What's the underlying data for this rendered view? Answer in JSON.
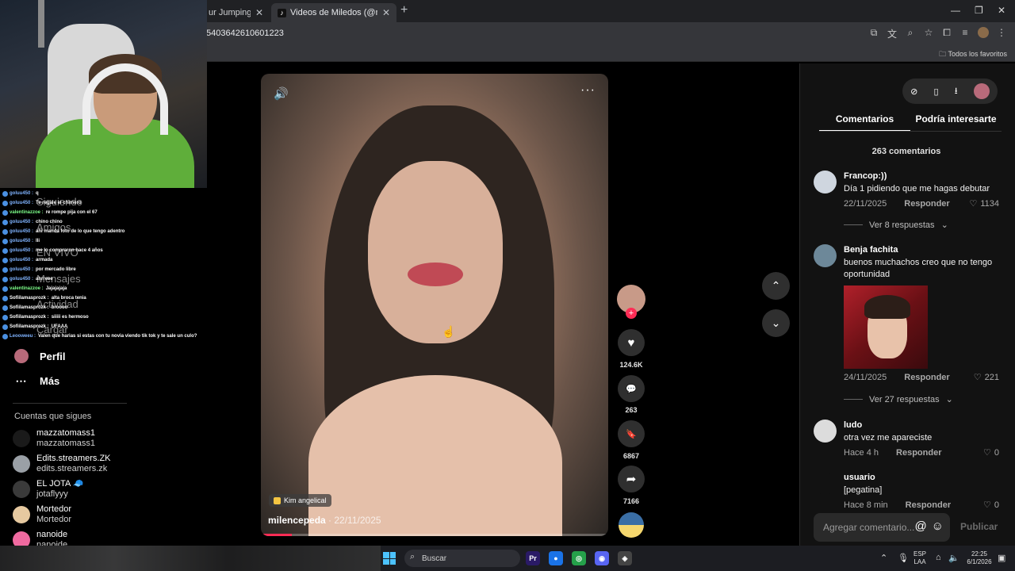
{
  "browser": {
    "tabs": [
      {
        "label": "ur Jumping Ski",
        "close": "✕"
      },
      {
        "label": "Videos de Miledos (@milen",
        "close": "✕"
      }
    ],
    "new_tab": "+",
    "url": "5403642610601223",
    "bookmarks_folder": "Todos los favoritos",
    "window_controls": [
      "—",
      "❐",
      "✕"
    ]
  },
  "chat": [
    {
      "user": "goluu450 :",
      "msg": "q",
      "color": "#7fb3ff"
    },
    {
      "user": "goluu450 :",
      "msg": "Te regale el chimero",
      "color": "#7fb3ff"
    },
    {
      "user": "valentinazzoe :",
      "msg": "re rompe pija con el 67",
      "color": "#7dff8a"
    },
    {
      "user": "goluu450 :",
      "msg": "chino chino",
      "color": "#7fb3ff"
    },
    {
      "user": "goluu450 :",
      "msg": "ahi manda foto de lo que tengo adentro",
      "color": "#7fb3ff"
    },
    {
      "user": "goluu450 :",
      "msg": "lli",
      "color": "#7fb3ff"
    },
    {
      "user": "goluu450 :",
      "msg": "me lo compraron hace 4 años",
      "color": "#7fb3ff"
    },
    {
      "user": "goluu450 :",
      "msg": "armada",
      "color": "#7fb3ff"
    },
    {
      "user": "goluu450 :",
      "msg": "por mercado libre",
      "color": "#7fb3ff"
    },
    {
      "user": "goluu450 :",
      "msg": "ahrreee",
      "color": "#7fb3ff"
    },
    {
      "user": "valentinazzoe :",
      "msg": "Jajajajaja",
      "color": "#7dff8a"
    },
    {
      "user": "Sofiilamasprozk :",
      "msg": "alta broca tenia",
      "color": "#ffffff"
    },
    {
      "user": "Sofiilamasprozk :",
      "msg": "broooo",
      "color": "#ffffff"
    },
    {
      "user": "Sofiilamasprozk :",
      "msg": "siiiii es hermoso",
      "color": "#ffffff"
    },
    {
      "user": "Sofiilamasprozk :",
      "msg": "UFAAA",
      "color": "#ffffff"
    },
    {
      "user": "Leooweeu :",
      "msg": "Valen que harias si estas con tu novia viendo tik tok y te sale un culo?",
      "color": "#7fb3ff"
    }
  ],
  "sidebar": {
    "ghost_items": [
      "Siguiendo",
      "Amigos",
      "EN VIVO",
      "Mensajes",
      "Actividad",
      "Cargar"
    ],
    "profile_label": "Perfil",
    "more_label": "Más",
    "more_icon": "⋯",
    "following_title": "Cuentas que sigues",
    "following": [
      {
        "name": "mazzatomass1",
        "handle": "mazzatomass1",
        "color": "#1a1a1a"
      },
      {
        "name": "Edits.streamers.ZK",
        "handle": "edits.streamers.zk",
        "color": "#9aa0a6"
      },
      {
        "name": "EL JOTA 🧢",
        "handle": "jotaflyyy",
        "color": "#3a3a3a"
      },
      {
        "name": "Mortedor",
        "handle": "Mortedor",
        "color": "#e6c9a0"
      },
      {
        "name": "nanoide",
        "handle": "nanoide",
        "color": "#f06aa0"
      }
    ]
  },
  "video": {
    "volume_icon": "🔊",
    "more_icon": "···",
    "tag": "Kim angelical",
    "author": "milencepeda",
    "date": " · 22/11/2025",
    "progress": 0.09
  },
  "actions": {
    "follow_plus": "+",
    "likes": "124.6K",
    "comments": "263",
    "saves": "6867",
    "shares": "7166",
    "like_icon": "♥",
    "comment_icon": "💬",
    "save_icon": "🔖",
    "share_icon": "➦",
    "up_icon": "⌃",
    "down_icon": "⌄"
  },
  "panel": {
    "tools": [
      "⊘",
      "▯",
      "⭳"
    ],
    "tabs": [
      "Comentarios",
      "Podría interesarte"
    ],
    "comment_count": "263 comentarios",
    "comments": [
      {
        "name": "Francop:))",
        "text": "Día 1 pidiendo que me hagas debutar",
        "time": "22/11/2025",
        "reply": "Responder",
        "likes": "1134",
        "avatar": "#cfd6df",
        "more": "Ver 8 respuestas"
      },
      {
        "name": "Benja fachita",
        "text": "buenos muchachos creo que no tengo oportunidad",
        "time": "24/11/2025",
        "reply": "Responder",
        "likes": "221",
        "avatar": "#6d8899",
        "more": "Ver 27 respuestas"
      },
      {
        "name": "ludo",
        "text": "otra vez me apareciste",
        "time": "Hace 4 h",
        "reply": "Responder",
        "likes": "0",
        "avatar": "#dcdcdc",
        "more": ""
      },
      {
        "name": "usuario",
        "text": "[pegatina]",
        "time": "Hace 8 min",
        "reply": "Responder",
        "likes": "0",
        "avatar": "#121212",
        "more": ""
      }
    ],
    "input_placeholder": "Agregar comentario...",
    "input_icons": [
      "@",
      "☺"
    ],
    "publish": "Publicar"
  },
  "taskbar": {
    "search": "Buscar",
    "lang": "ESP",
    "region": "LAA",
    "time": "22:25",
    "date": "6/1/2026",
    "apps": [
      {
        "label": "Pr",
        "color": "#2a1a66"
      },
      {
        "label": "●",
        "color": "#1a73e8"
      },
      {
        "label": "◎",
        "color": "#25a04a"
      },
      {
        "label": "◉",
        "color": "#5865f2"
      },
      {
        "label": "◈",
        "color": "#444"
      }
    ]
  }
}
